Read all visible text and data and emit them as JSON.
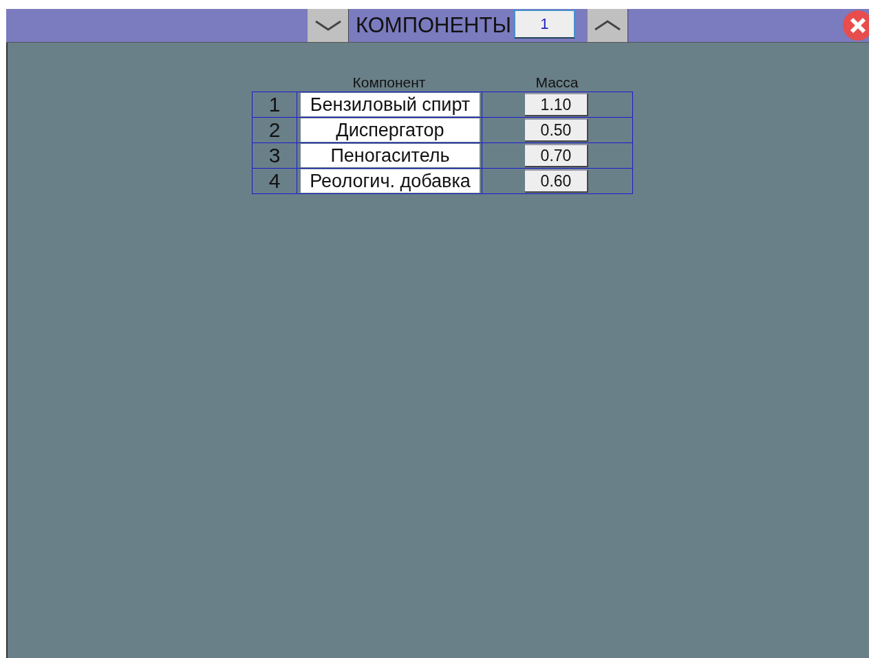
{
  "header": {
    "title": "КОМПОНЕНТЫ",
    "page_field": "1"
  },
  "table": {
    "columns": [
      "Компонент",
      "Масса"
    ],
    "rows": [
      {
        "number": "1",
        "component": "Бензиловый спирт",
        "mass": "1.10"
      },
      {
        "number": "2",
        "component": "Диспергатор",
        "mass": "0.50"
      },
      {
        "number": "3",
        "component": "Пеногаситель",
        "mass": "0.70"
      },
      {
        "number": "4",
        "component": "Реологич. добавка",
        "mass": "0.60"
      }
    ]
  }
}
